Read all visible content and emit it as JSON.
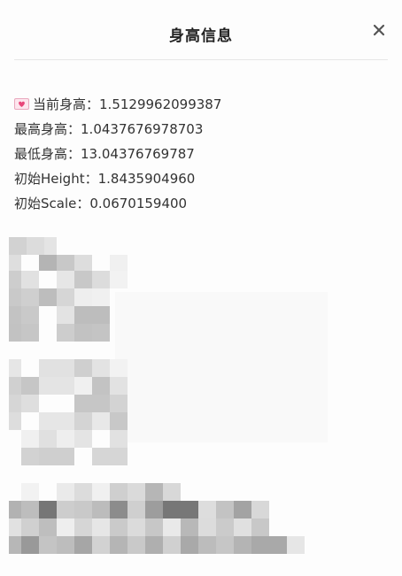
{
  "dialog": {
    "title": "身高信息",
    "close_icon": "close-icon"
  },
  "info": {
    "current_icon": "heart-letter-icon",
    "rows": [
      {
        "label": "当前身高：",
        "value": "1.5129962099387"
      },
      {
        "label": "最高身高：",
        "value": "1.0437676978703"
      },
      {
        "label": "最低身高：",
        "value": "13.04376769787"
      },
      {
        "label": "初始Height：",
        "value": "1.8435904960"
      },
      {
        "label": "初始Scale：",
        "value": "0.0670159400"
      }
    ]
  },
  "colors": {
    "background": "#fdfdfd",
    "text": "#333333",
    "divider": "#e6e6e6",
    "emoji_pink": "#f07aa0"
  }
}
